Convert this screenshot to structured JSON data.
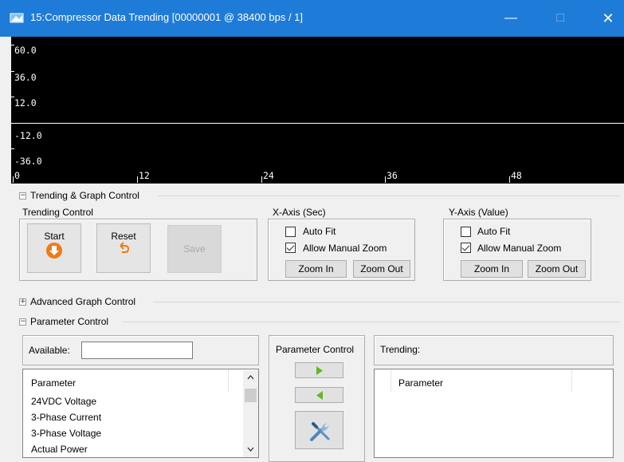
{
  "window": {
    "title": "15:Compressor Data Trending [00000001 @ 38400 bps / 1]",
    "minimize": "—",
    "maximize": "□",
    "close": "✕"
  },
  "graph": {
    "y_labels": [
      "60.0",
      "36.0",
      "12.0",
      "-12.0",
      "-36.0"
    ],
    "x_labels": [
      "0",
      "12",
      "24",
      "36",
      "48"
    ]
  },
  "trending_graph_control": {
    "title": "Trending & Graph Control",
    "trending_control": {
      "label": "Trending Control",
      "start": "Start",
      "reset": "Reset",
      "save": "Save"
    },
    "x_axis": {
      "label": "X-Axis (Sec)",
      "auto_fit": "Auto Fit",
      "auto_fit_checked": false,
      "manual_zoom": "Allow Manual Zoom",
      "manual_zoom_checked": true,
      "zoom_in": "Zoom In",
      "zoom_out": "Zoom Out"
    },
    "y_axis": {
      "label": "Y-Axis (Value)",
      "auto_fit": "Auto Fit",
      "auto_fit_checked": false,
      "manual_zoom": "Allow Manual Zoom",
      "manual_zoom_checked": true,
      "zoom_in": "Zoom In",
      "zoom_out": "Zoom Out"
    }
  },
  "advanced_graph_control": {
    "title": "Advanced Graph Control"
  },
  "parameter_control": {
    "title": "Parameter Control",
    "available_label": "Available:",
    "available_value": "",
    "list_header": "Parameter",
    "items": [
      "24VDC Voltage",
      "3-Phase Current",
      "3-Phase Voltage",
      "Actual Power"
    ],
    "center_label": "Parameter Control",
    "trending_label": "Trending:",
    "trending_header": "Parameter"
  }
}
